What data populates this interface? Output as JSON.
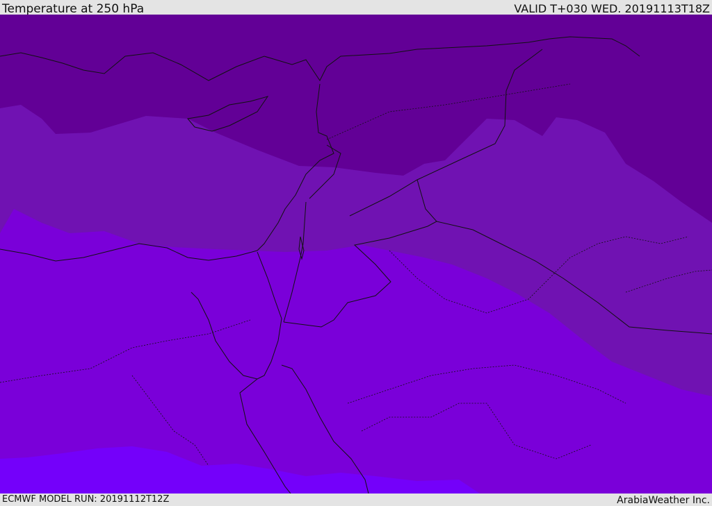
{
  "header": {
    "title": "Temperature at 250 hPa",
    "valid": "VALID T+030 WED. 20191113T18Z"
  },
  "footer": {
    "model_run": "ECMWF MODEL RUN: 20191112T12Z",
    "credit": "ArabiaWeather Inc."
  },
  "map": {
    "region": "Eastern Mediterranean / Middle East",
    "bands": [
      {
        "name": "band-1",
        "color": "#620096"
      },
      {
        "name": "band-2",
        "color": "#7012b2"
      },
      {
        "name": "band-3",
        "color": "#7a00d9"
      },
      {
        "name": "band-4",
        "color": "#7400fa"
      }
    ],
    "line_color": "#111111"
  }
}
